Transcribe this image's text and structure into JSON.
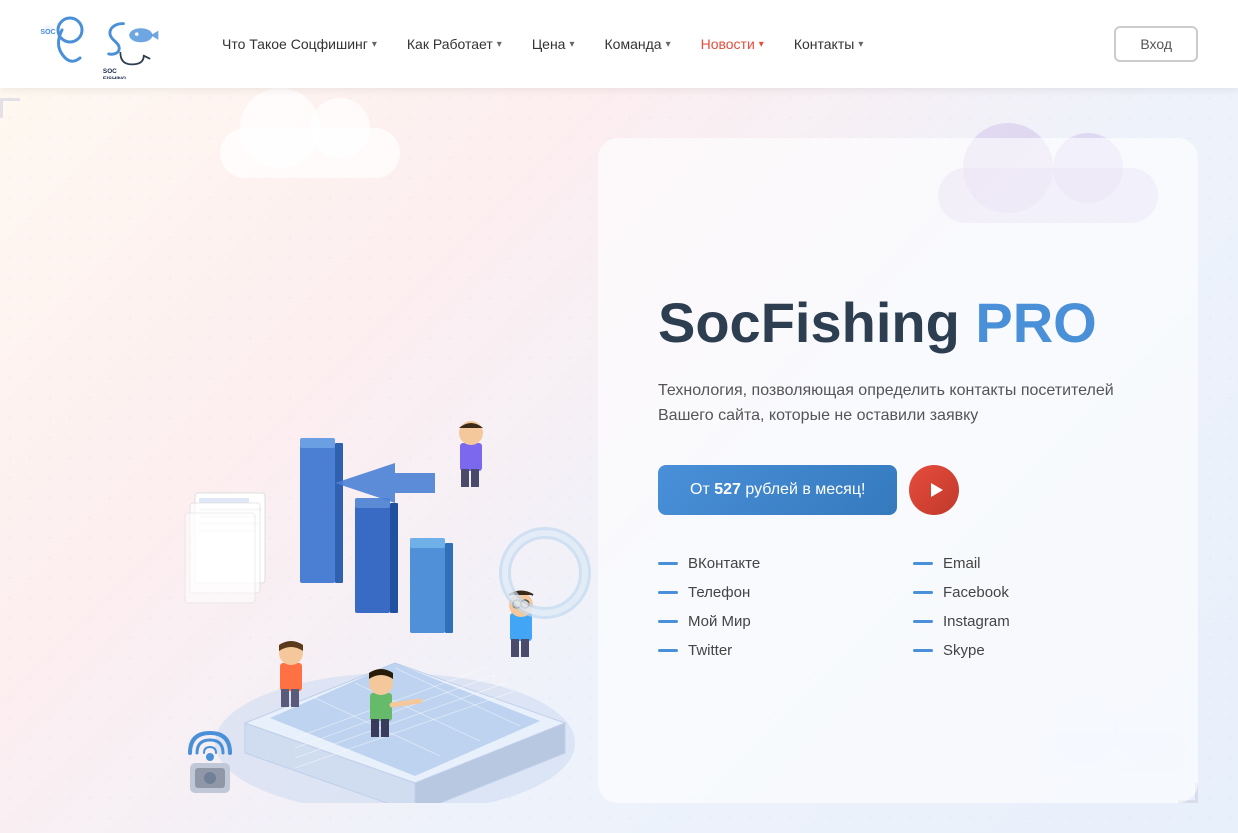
{
  "nav": {
    "logo_alt": "SocFishing",
    "links": [
      {
        "label": "Что Такое Соцфишинг",
        "has_dropdown": true,
        "active": false
      },
      {
        "label": "Как Работает",
        "has_dropdown": true,
        "active": false
      },
      {
        "label": "Цена",
        "has_dropdown": true,
        "active": false
      },
      {
        "label": "Команда",
        "has_dropdown": true,
        "active": false
      },
      {
        "label": "Новости",
        "has_dropdown": true,
        "active": true
      },
      {
        "label": "Контакты",
        "has_dropdown": true,
        "active": false
      }
    ],
    "login_label": "Вход"
  },
  "hero": {
    "title_main": "SocFishing ",
    "title_pro": "PRO",
    "subtitle": "Технология, позволяющая определить контакты посетителей Вашего сайта, которые не оставили заявку",
    "cta_prefix": "От ",
    "cta_price": "527",
    "cta_suffix": " рублей в месяц!",
    "features_col1": [
      "ВКонтакте",
      "Телефон",
      "Мой Мир",
      "Twitter"
    ],
    "features_col2": [
      "Email",
      "Facebook",
      "Instagram",
      "Skype"
    ]
  },
  "colors": {
    "accent_blue": "#4a90d9",
    "accent_red": "#e74c3c",
    "text_dark": "#2c3e50",
    "text_mid": "#555",
    "dash_color": "#4a90d9"
  }
}
